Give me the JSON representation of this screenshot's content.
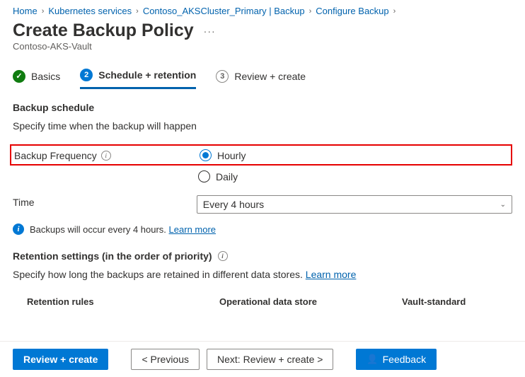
{
  "breadcrumb": {
    "items": [
      "Home",
      "Kubernetes services",
      "Contoso_AKSCluster_Primary | Backup",
      "Configure Backup"
    ]
  },
  "page": {
    "title": "Create Backup Policy",
    "subtitle": "Contoso-AKS-Vault"
  },
  "steps": {
    "s1": {
      "label": "Basics",
      "check": "✓"
    },
    "s2": {
      "label": "Schedule + retention",
      "num": "2"
    },
    "s3": {
      "label": "Review + create",
      "num": "3"
    }
  },
  "schedule": {
    "heading": "Backup schedule",
    "desc": "Specify time when the backup will happen",
    "freq_label": "Backup Frequency",
    "opt_hourly": "Hourly",
    "opt_daily": "Daily",
    "time_label": "Time",
    "time_value": "Every 4 hours",
    "info_text": "Backups will occur every 4 hours.",
    "learn_more": "Learn more"
  },
  "retention": {
    "heading": "Retention settings (in the order of priority)",
    "desc_a": "Specify how long the backups are retained in different data stores.",
    "learn_more": "Learn more",
    "col_rules": "Retention rules",
    "col_op": "Operational data store",
    "col_vault": "Vault-standard"
  },
  "footer": {
    "review": "Review + create",
    "prev": "<  Previous",
    "next": "Next: Review + create  >",
    "feedback": "Feedback"
  }
}
